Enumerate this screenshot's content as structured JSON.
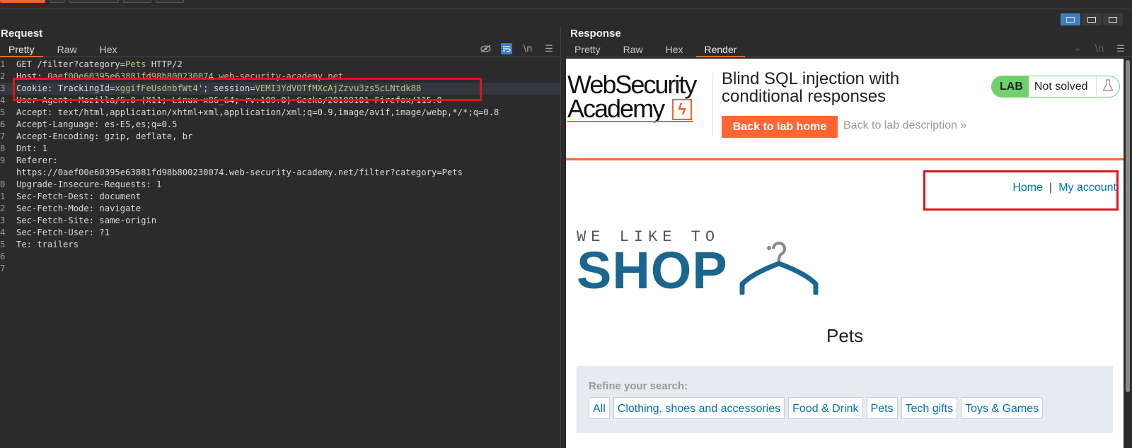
{
  "request": {
    "title": "Request",
    "tabs": [
      "Pretty",
      "Raw",
      "Hex"
    ],
    "active_tab": "Pretty",
    "tools": [
      "hide-icon",
      "wrap-icon",
      "newline-icon",
      "menu-icon"
    ],
    "tool_labels": {
      "newline": "\\n"
    },
    "lines": [
      {
        "n": "1",
        "parts": [
          [
            "k",
            "GET /filter?category="
          ],
          [
            "v",
            "Pets"
          ],
          [
            "k",
            " HTTP/2"
          ]
        ]
      },
      {
        "n": "2",
        "parts": [
          [
            "k",
            "Host: "
          ],
          [
            "u",
            "0aef00e60395e63881fd98b800230074.web-security-academy.net"
          ]
        ]
      },
      {
        "n": "3",
        "parts": [
          [
            "k",
            "Cookie: TrackingId="
          ],
          [
            "v",
            "xggifFeUsdnbfWt4'"
          ],
          [
            "k",
            "; session="
          ],
          [
            "v",
            "VEMI3YdVOTfMXcAjZzvu3zs5cLNtdk88"
          ]
        ],
        "highlight": true
      },
      {
        "n": "4",
        "parts": [
          [
            "k",
            "User-Agent: Mozilla/5.0 (X11; Linux x86_64; rv:109.0) Gecko/20100101 Firefox/115.0"
          ]
        ]
      },
      {
        "n": "5",
        "parts": [
          [
            "k",
            "Accept: text/html,application/xhtml+xml,application/xml;q=0.9,image/avif,image/webp,*/*;q=0.8"
          ]
        ]
      },
      {
        "n": "6",
        "parts": [
          [
            "k",
            "Accept-Language: es-ES,es;q=0.5"
          ]
        ]
      },
      {
        "n": "7",
        "parts": [
          [
            "k",
            "Accept-Encoding: gzip, deflate, br"
          ]
        ]
      },
      {
        "n": "8",
        "parts": [
          [
            "k",
            "Dnt: 1"
          ]
        ]
      },
      {
        "n": "9",
        "parts": [
          [
            "k",
            "Referer:"
          ]
        ]
      },
      {
        "n": "",
        "parts": [
          [
            "k",
            "https://0aef00e60395e63881fd98b800230074.web-security-academy.net/filter?category=Pets"
          ]
        ]
      },
      {
        "n": "0",
        "parts": [
          [
            "k",
            "Upgrade-Insecure-Requests: 1"
          ]
        ]
      },
      {
        "n": "1",
        "parts": [
          [
            "k",
            "Sec-Fetch-Dest: document"
          ]
        ]
      },
      {
        "n": "2",
        "parts": [
          [
            "k",
            "Sec-Fetch-Mode: navigate"
          ]
        ]
      },
      {
        "n": "3",
        "parts": [
          [
            "k",
            "Sec-Fetch-Site: same-origin"
          ]
        ]
      },
      {
        "n": "4",
        "parts": [
          [
            "k",
            "Sec-Fetch-User: ?1"
          ]
        ]
      },
      {
        "n": "5",
        "parts": [
          [
            "k",
            "Te: trailers"
          ]
        ]
      },
      {
        "n": "6",
        "parts": []
      },
      {
        "n": "7",
        "parts": []
      }
    ]
  },
  "response": {
    "title": "Response",
    "tabs": [
      "Pretty",
      "Raw",
      "Hex",
      "Render"
    ],
    "active_tab": "Render",
    "tool_labels": {
      "newline": "\\n"
    },
    "page": {
      "logo_line1": "WebSecurity",
      "logo_line2": "Academy",
      "lab_title": "Blind SQL injection with conditional responses",
      "back_button": "Back to lab home",
      "back_description": "Back to lab description",
      "desc_chevron": "»",
      "lab_badge": "LAB",
      "lab_status": "Not solved",
      "nav_home": "Home",
      "nav_separator": "|",
      "nav_account": "My account",
      "shop_tagline": "WE LIKE TO",
      "shop_name": "SHOP",
      "category_title": "Pets",
      "refine_label": "Refine your search:",
      "categories": [
        "All",
        "Clothing, shoes and accessories",
        "Food & Drink",
        "Pets",
        "Tech gifts",
        "Toys & Games"
      ]
    }
  },
  "colors": {
    "accent_orange": "#e8682a",
    "highlight_box": "#e0141e",
    "link_blue": "#0071bc",
    "lab_green": "#70d16c"
  }
}
